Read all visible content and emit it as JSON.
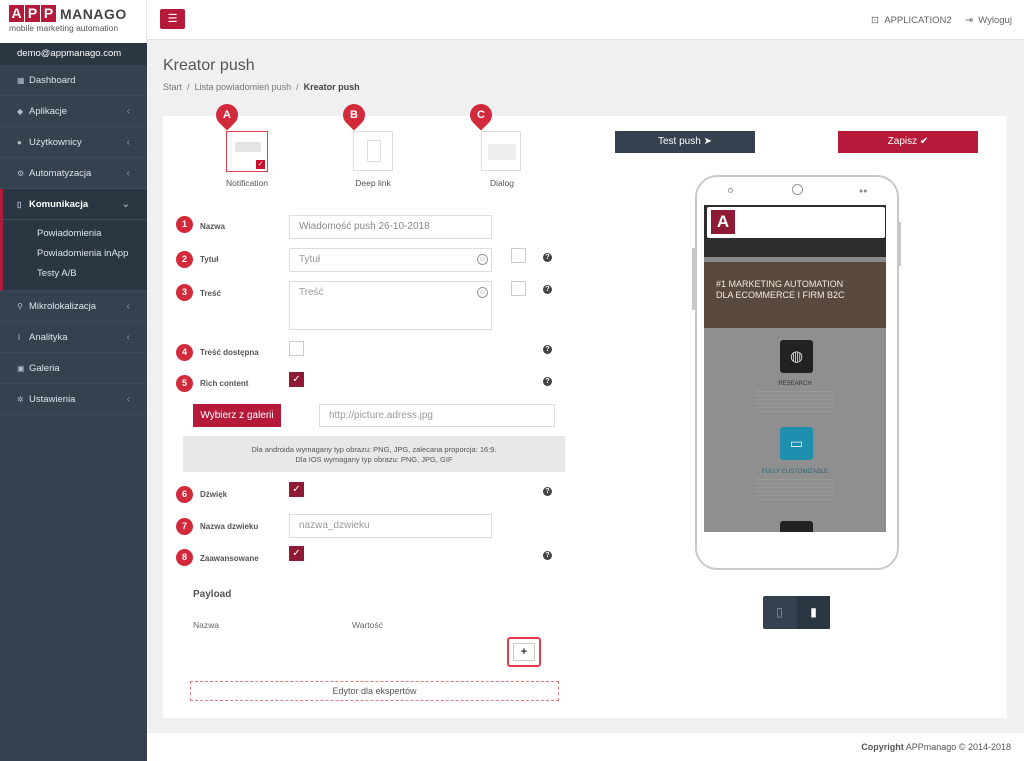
{
  "logo": {
    "letters": [
      "A",
      "P",
      "P"
    ],
    "word": "MANAGO",
    "sub": "mobile marketing automation"
  },
  "user": {
    "email": "demo@appmanago.com"
  },
  "nav": [
    {
      "label": "Dashboard",
      "icon": "grid-icon"
    },
    {
      "label": "Aplikacje",
      "icon": "diamond-icon",
      "arrow": "‹"
    },
    {
      "label": "Użytkownicy",
      "icon": "users-icon",
      "arrow": "‹"
    },
    {
      "label": "Automatyzacja",
      "icon": "cogs-icon",
      "arrow": "‹"
    },
    {
      "label": "Komunikacja",
      "icon": "mobile-icon",
      "arrow": "⌄"
    },
    {
      "label": "Mikrolokalizacja",
      "icon": "map-marker-icon",
      "arrow": "‹"
    },
    {
      "label": "Analityka",
      "icon": "line-chart-icon",
      "arrow": "‹"
    },
    {
      "label": "Galeria",
      "icon": "image-icon"
    },
    {
      "label": "Ustawienia",
      "icon": "gear-icon",
      "arrow": "‹"
    }
  ],
  "subnav": [
    "Powiadomienia",
    "Powiadomienia inApp",
    "Testy A/B"
  ],
  "topbar": {
    "app": "APPLICATION2",
    "logout": "Wyloguj"
  },
  "page": {
    "title": "Kreator push",
    "crumbs": [
      "Start",
      "Lista powiadomień push",
      "Kreator push"
    ]
  },
  "types": [
    {
      "marker": "A",
      "label": "Notification"
    },
    {
      "marker": "B",
      "label": "Deep link"
    },
    {
      "marker": "C",
      "label": "Dialog"
    }
  ],
  "form": {
    "nazwa": {
      "num": "1",
      "label": "Nazwa",
      "value": "Wiadomość push 26-10-2018"
    },
    "tytul": {
      "num": "2",
      "label": "Tytuł",
      "placeholder": "Tytuł"
    },
    "tresc": {
      "num": "3",
      "label": "Treść",
      "placeholder": "Treść"
    },
    "tresc_dostepna": {
      "num": "4",
      "label": "Treść dostępna"
    },
    "rich": {
      "num": "5",
      "label": "Rich content"
    },
    "gallery_button": "Wybierz z galerii",
    "picture_placeholder": "http://picture.adress.jpg",
    "info1": "Dla androida wymagany typ obrazu: PNG, JPG, zalecana proporcja: 16:9.",
    "info2": "Dla IOS wymagany typ obrazu: PNG, JPG, GIF",
    "dzwiek": {
      "num": "6",
      "label": "Dźwięk"
    },
    "nazwa_dzwieku": {
      "num": "7",
      "label": "Nazwa dzwieku",
      "placeholder": "nazwa_dzwieku"
    },
    "zaawansowane": {
      "num": "8",
      "label": "Zaawansowane"
    }
  },
  "payload": {
    "title": "Payload",
    "col1": "Nazwa",
    "col2": "Wartość",
    "add": "+",
    "expert": "Edytor dla ekspertów"
  },
  "actions": {
    "test": "Test push",
    "save": "Zapisz"
  },
  "preview": {
    "badge": "A",
    "headline1": "#1 MARKETING AUTOMATION",
    "headline2": "DLA ECOMMERCE I FIRM B2C",
    "sec1": "RESEARCH",
    "sec2": "FULLY CUSTOMIZABLE"
  },
  "footer": {
    "bold": "Copyright",
    "text": "APPmanago © 2014-2018"
  },
  "colors": {
    "accent": "#b51a3b",
    "sidebar": "#364150",
    "dark_button": "#364150"
  }
}
